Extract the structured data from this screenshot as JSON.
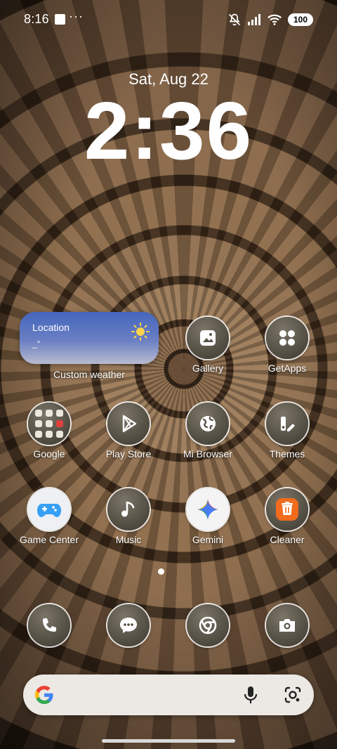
{
  "status_bar": {
    "time": "8:16",
    "more_indicator": "···",
    "battery": "100",
    "icons": [
      "notification-square-icon",
      "mute-icon",
      "signal-icon",
      "wifi-icon",
      "battery-icon"
    ]
  },
  "lock_clock": {
    "date": "Sat, Aug 22",
    "time": "2:36"
  },
  "weather_widget": {
    "location": "Location",
    "temperature": "_°",
    "label": "Custom weather",
    "icon": "sun-icon"
  },
  "apps": {
    "gallery": "Gallery",
    "getapps": "GetApps",
    "google": "Google",
    "play_store": "Play Store",
    "mi_browser": "Mi Browser",
    "themes": "Themes",
    "game_center": "Game Center",
    "music": "Music",
    "gemini": "Gemini",
    "cleaner": "Cleaner"
  },
  "dock": [
    "phone-icon",
    "messages-icon",
    "chrome-icon",
    "camera-icon"
  ],
  "search_bar": {
    "icons": [
      "google-logo-icon",
      "microphone-icon",
      "google-lens-icon"
    ]
  },
  "colors": {
    "cleaner_orange": "#f26b1d",
    "weather_top": "#4466bd",
    "weather_bottom": "#b8bbcf",
    "search_bg": "#ece9e4"
  }
}
